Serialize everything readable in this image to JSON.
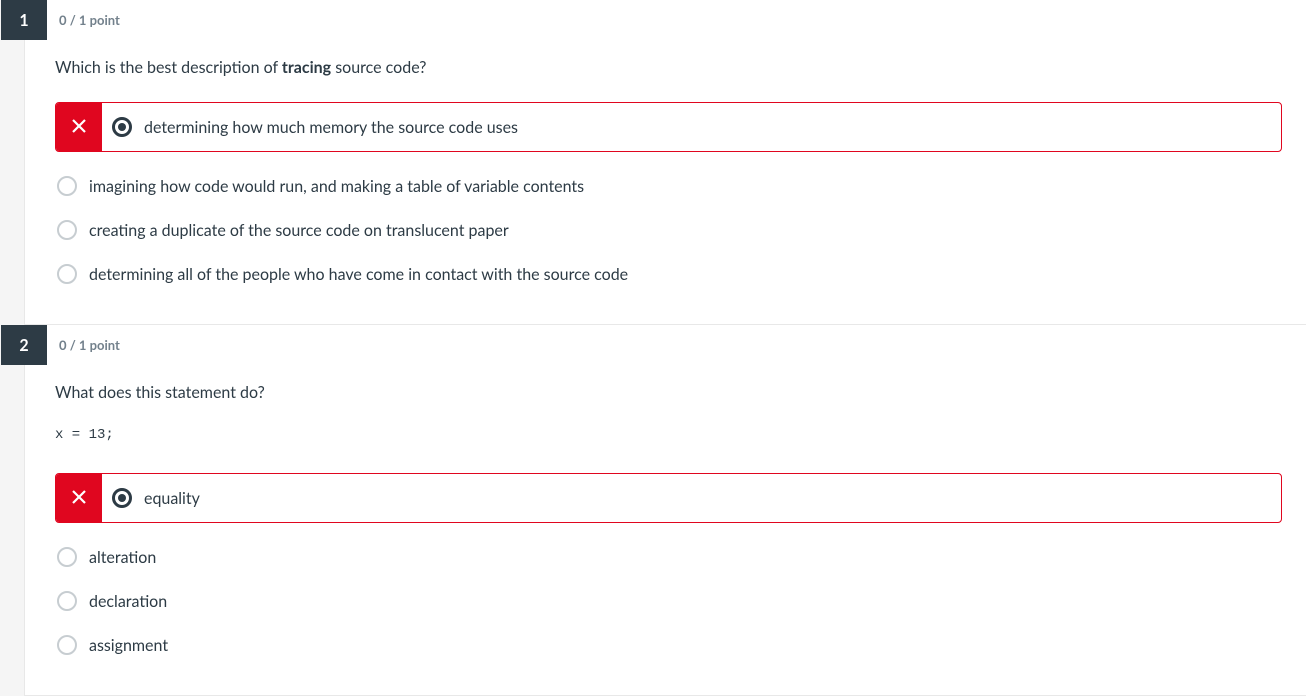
{
  "questions": [
    {
      "number": "1",
      "points": "0 / 1 point",
      "prompt_before": "Which is the best description of ",
      "prompt_bold": "tracing",
      "prompt_after": " source code?",
      "code": "",
      "selected_wrong": "determining how much memory the source code uses",
      "others": [
        "imagining how code would run, and making a table of variable contents",
        "creating a duplicate of the source code on translucent paper",
        "determining all of the people who have come in contact with the source code"
      ]
    },
    {
      "number": "2",
      "points": "0 / 1 point",
      "prompt_before": "What does this statement do?",
      "prompt_bold": "",
      "prompt_after": "",
      "code": "x = 13;",
      "selected_wrong": "equality",
      "others": [
        "alteration",
        "declaration",
        "assignment"
      ]
    }
  ]
}
